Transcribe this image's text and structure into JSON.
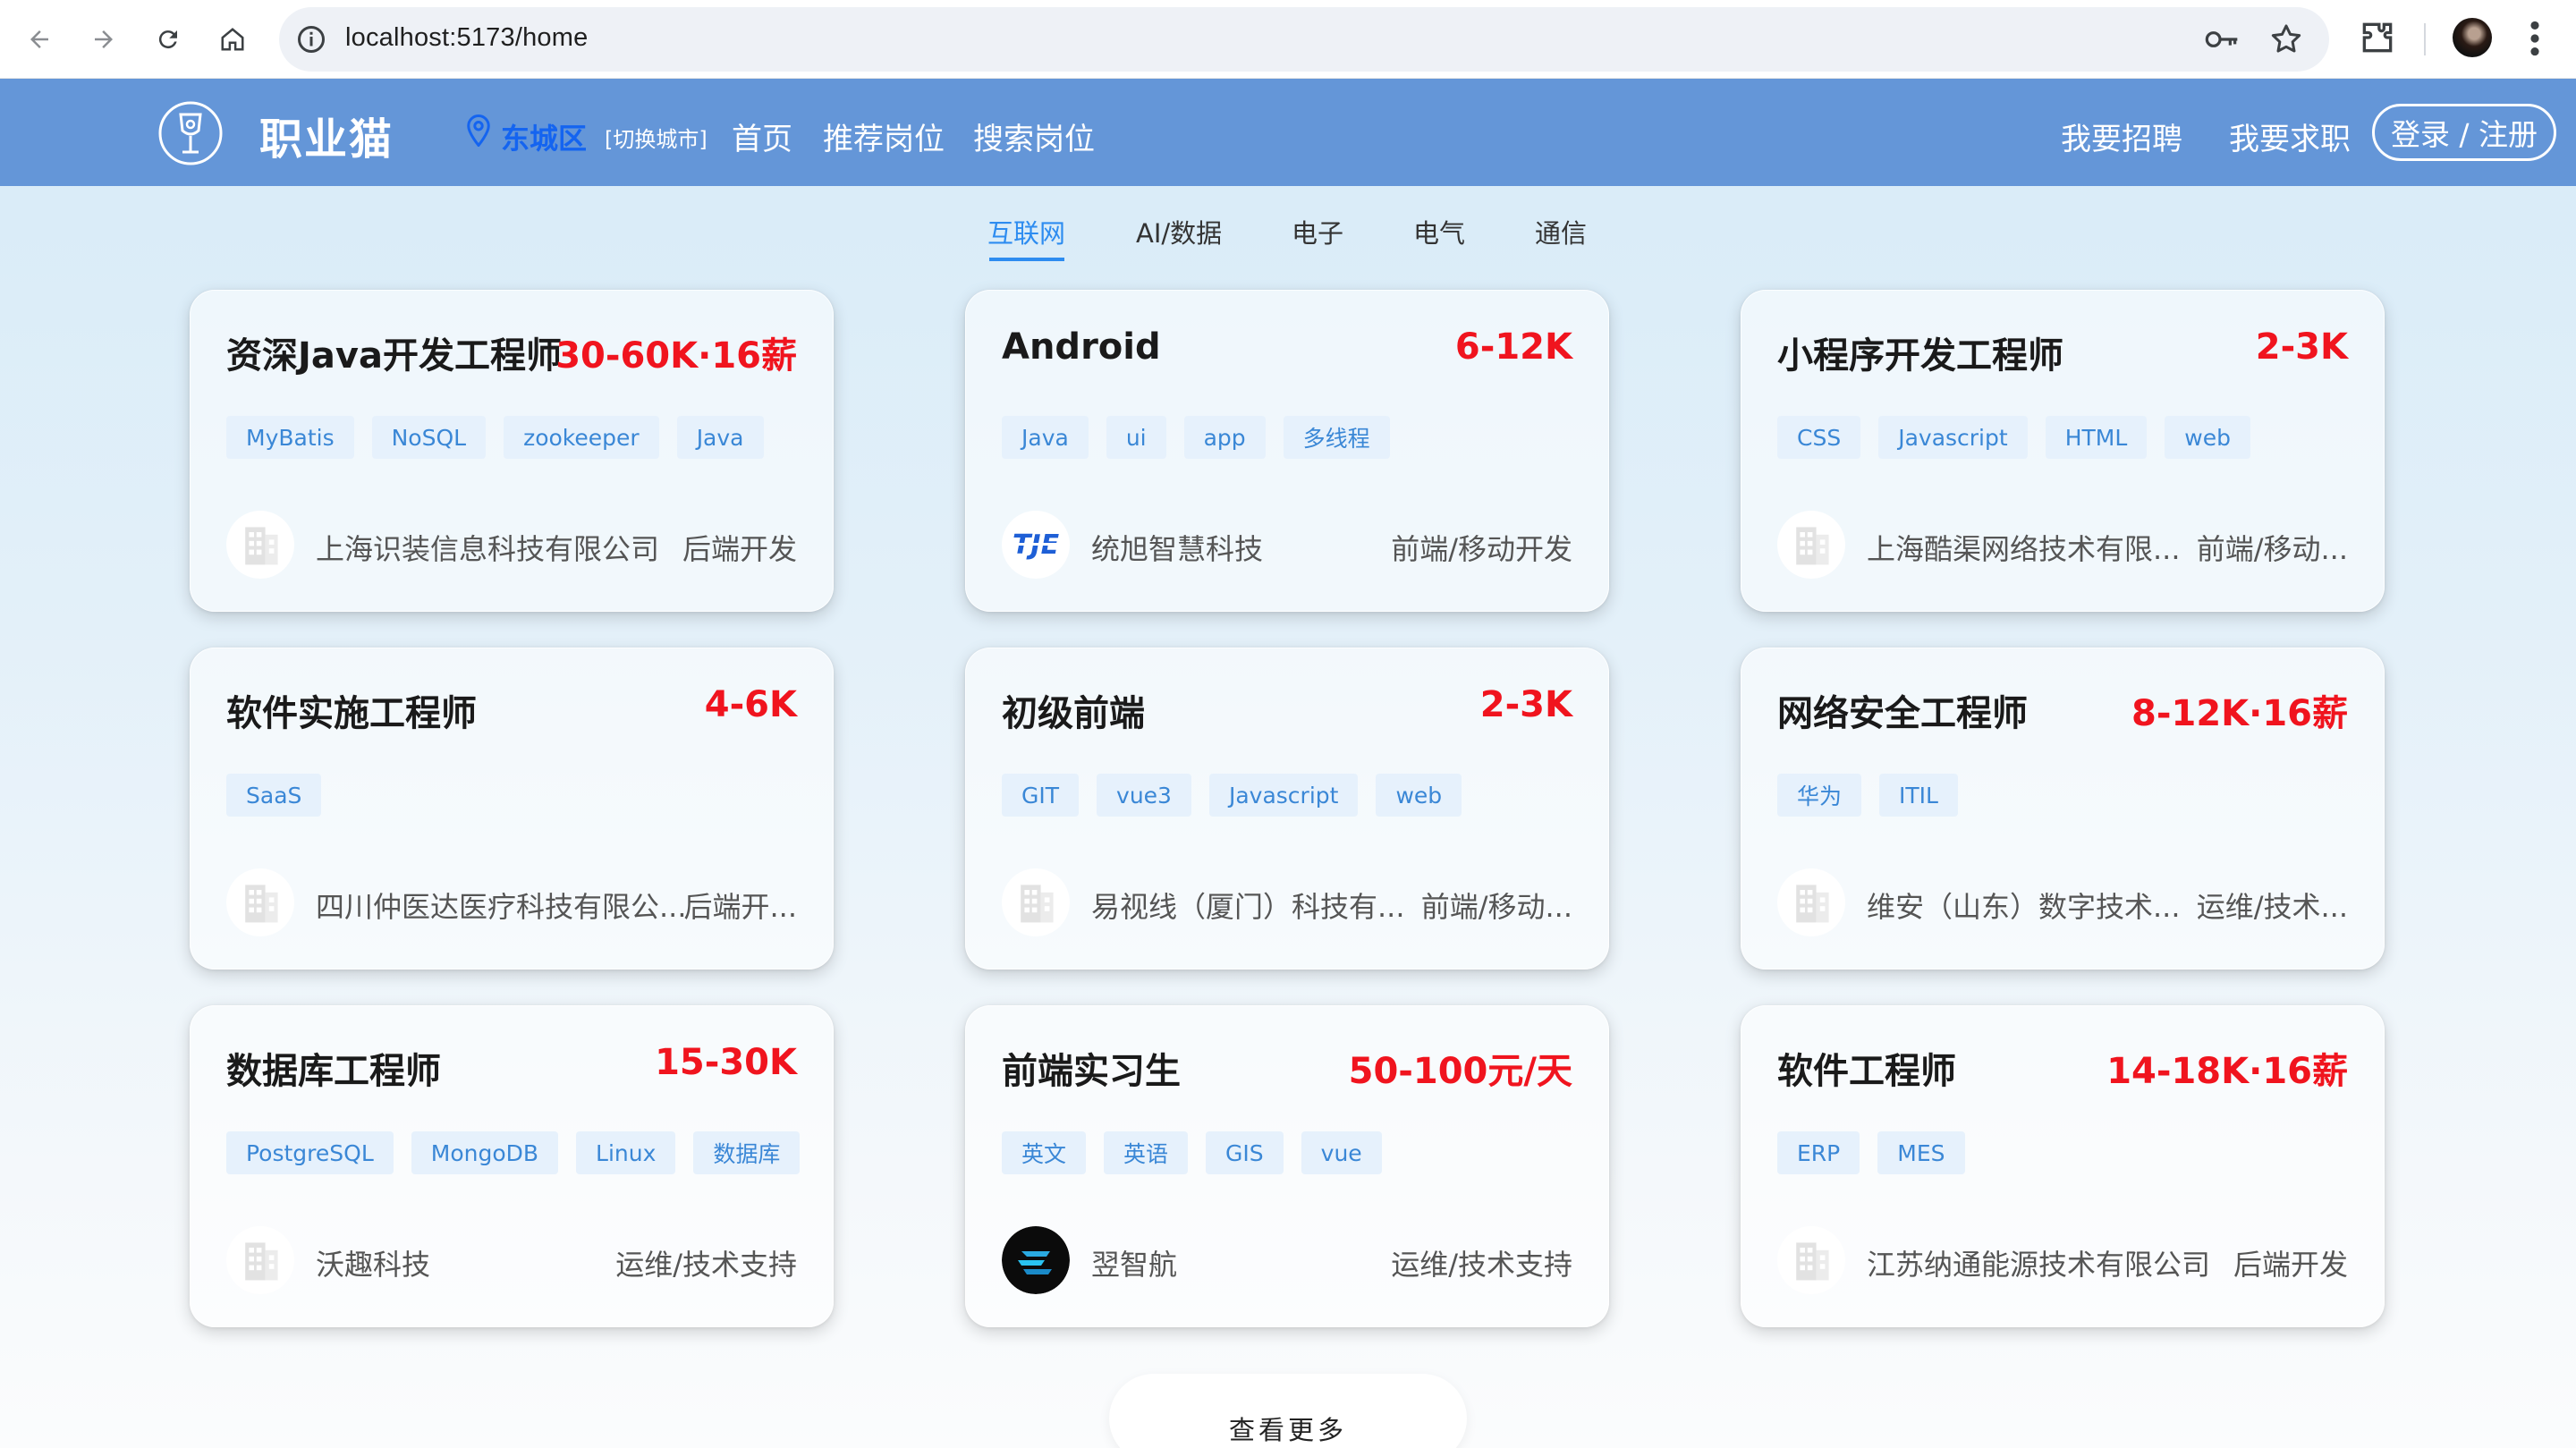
{
  "browser": {
    "url": "localhost:5173/home"
  },
  "header": {
    "logo_text": "职业猫",
    "location": "东城区",
    "switch_city": "[切换城市]",
    "nav": [
      "首页",
      "推荐岗位",
      "搜索岗位"
    ],
    "recruit": "我要招聘",
    "seek_job": "我要求职",
    "login": "登录 / 注册"
  },
  "tabs": [
    "互联网",
    "AI/数据",
    "电子",
    "电气",
    "通信"
  ],
  "active_tab": "互联网",
  "jobs": [
    {
      "title": "资深Java开发工程师",
      "salary": "30-60K·16薪",
      "tags": [
        "MyBatis",
        "NoSQL",
        "zookeeper",
        "Java"
      ],
      "company": "上海识装信息科技有限公司",
      "category": "后端开发",
      "logo": "building-icon"
    },
    {
      "title": "Android",
      "salary": "6-12K",
      "tags": [
        "Java",
        "ui",
        "app",
        "多线程"
      ],
      "company": "统旭智慧科技",
      "category": "前端/移动开发",
      "logo": "tje-logo"
    },
    {
      "title": "小程序开发工程师",
      "salary": "2-3K",
      "tags": [
        "CSS",
        "Javascript",
        "HTML",
        "web"
      ],
      "company": "上海酷渠网络技术有限...",
      "category": "前端/移动...",
      "logo": "building-icon"
    },
    {
      "title": "软件实施工程师",
      "salary": "4-6K",
      "tags": [
        "SaaS"
      ],
      "company": "四川仲医达医疗科技有限公...",
      "category": "后端开...",
      "logo": "building-icon"
    },
    {
      "title": "初级前端",
      "salary": "2-3K",
      "tags": [
        "GIT",
        "vue3",
        "Javascript",
        "web"
      ],
      "company": "易视线（厦门）科技有...",
      "category": "前端/移动...",
      "logo": "building-icon"
    },
    {
      "title": "网络安全工程师",
      "salary": "8-12K·16薪",
      "tags": [
        "华为",
        "ITIL"
      ],
      "company": "维安（山东）数字技术...",
      "category": "运维/技术...",
      "logo": "building-icon"
    },
    {
      "title": "数据库工程师",
      "salary": "15-30K",
      "tags": [
        "PostgreSQL",
        "MongoDB",
        "Linux",
        "数据库"
      ],
      "company": "沃趣科技",
      "category": "运维/技术支持",
      "logo": "building-icon"
    },
    {
      "title": "前端实习生",
      "salary": "50-100元/天",
      "tags": [
        "英文",
        "英语",
        "GIS",
        "vue"
      ],
      "company": "翌智航",
      "category": "运维/技术支持",
      "logo": "e-logo"
    },
    {
      "title": "软件工程师",
      "salary": "14-18K·16薪",
      "tags": [
        "ERP",
        "MES"
      ],
      "company": "江苏纳通能源技术有限公司",
      "category": "后端开发",
      "logo": "building-icon"
    }
  ],
  "more_button": "查看更多",
  "colors": {
    "header_bg": "#6496d8",
    "salary": "#f0141e",
    "tag_bg": "#e6f1fc",
    "tag_text": "#3a87d6",
    "active_tab": "#2d8cf0",
    "location": "#1464f0"
  }
}
